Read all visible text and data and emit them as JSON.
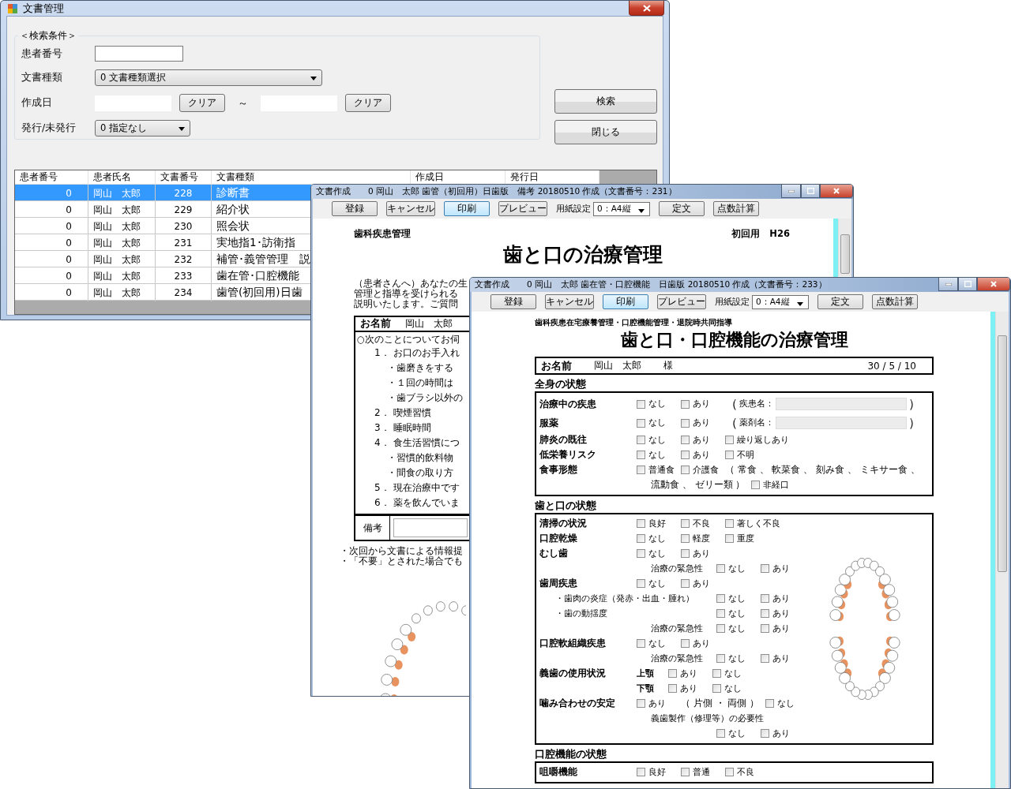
{
  "manager_window": {
    "title": "文書管理",
    "search": {
      "legend": "＜検索条件＞",
      "patient_label": "患者番号",
      "type_label": "文書種類",
      "type_value": "0 文書種類選択",
      "date_label": "作成日",
      "clear_buttons": [
        "クリア",
        "クリア"
      ],
      "separator": "～",
      "issued_label": "発行/未発行",
      "issued_value": "0 指定なし"
    },
    "buttons": [
      "検索",
      "閉じる"
    ],
    "table": {
      "columns": [
        "患者番号",
        "患者氏名",
        "文書番号",
        "文書種類",
        "作成日",
        "発行日"
      ],
      "rows": [
        {
          "cells": [
            "0",
            "岡山　太郎",
            "228",
            "診断書"
          ],
          "selected": true
        },
        {
          "cells": [
            "0",
            "岡山　太郎",
            "229",
            "紹介状"
          ],
          "selected": false
        },
        {
          "cells": [
            "0",
            "岡山　太郎",
            "230",
            "照会状"
          ],
          "selected": false
        },
        {
          "cells": [
            "0",
            "岡山　太郎",
            "231",
            "実地指1･訪衛指"
          ],
          "selected": false
        },
        {
          "cells": [
            "0",
            "岡山　太郎",
            "232",
            "補管･義管管理　説"
          ],
          "selected": false
        },
        {
          "cells": [
            "0",
            "岡山　太郎",
            "233",
            "歯在管･口腔機能"
          ],
          "selected": false
        },
        {
          "cells": [
            "0",
            "岡山　太郎",
            "234",
            "歯管(初回用)日歯"
          ],
          "selected": false
        }
      ]
    }
  },
  "letter_window": {
    "title": "文書作成　　0 岡山　太郎 歯管（初回用）日歯版　備考 20180510 作成（文書番号：231）",
    "toolbar": [
      {
        "kind": "button",
        "label": "登録",
        "default": false
      },
      {
        "kind": "button",
        "label": "キャンセル",
        "default": false
      },
      {
        "kind": "button",
        "label": "印刷",
        "default": true
      },
      {
        "kind": "button",
        "label": "プレビュー",
        "default": false
      },
      {
        "kind": "label",
        "label": "用紙設定"
      },
      {
        "kind": "select",
        "label": "0：A4縦"
      },
      {
        "kind": "button",
        "label": "定文",
        "default": false
      },
      {
        "kind": "button",
        "label": "点数計算",
        "default": false
      }
    ],
    "document": {
      "category": "歯科疾患管理",
      "edition": "初回用　H26",
      "heading": "歯と口の治療管理",
      "intro": [
        "（患者さんへ）あなたの生",
        "管理と指導を受けられる",
        "説明いたします。ご質問"
      ],
      "name_label": "お名前",
      "patient_name": "岡山　太郎",
      "question": "○次のことについてお伺",
      "items": [
        {
          "kind": "numbered",
          "number": "1．",
          "text": "お口のお手入れ"
        },
        {
          "kind": "bullet",
          "text": "・歯磨きをする"
        },
        {
          "kind": "bullet",
          "text": "・１回の時間は"
        },
        {
          "kind": "bullet",
          "text": "・歯ブラシ以外の"
        },
        {
          "kind": "numbered",
          "number": "2．",
          "text": "喫煙習慣"
        },
        {
          "kind": "numbered",
          "number": "3．",
          "text": "睡眠時間"
        },
        {
          "kind": "numbered",
          "number": "4．",
          "text": "食生活習慣につ"
        },
        {
          "kind": "bullet",
          "text": "・習慣的飲料物"
        },
        {
          "kind": "bullet",
          "text": "・間食の取り方"
        },
        {
          "kind": "numbered",
          "number": "5．",
          "text": "現在治療中です"
        },
        {
          "kind": "numbered",
          "number": "6．",
          "text": "薬を飲んでいま"
        }
      ],
      "remarks_label": "備考",
      "notes": [
        "・次回から文書による情報提",
        "・「不要」とされた場合でも"
      ]
    }
  },
  "form_window": {
    "title": "文書作成　　0 岡山　太郎 歯在管・口腔機能　日歯版 20180510 作成（文書番号：233）",
    "toolbar": [
      {
        "kind": "button",
        "label": "登録",
        "default": false
      },
      {
        "kind": "button",
        "label": "キャンセル",
        "default": false
      },
      {
        "kind": "button",
        "label": "印刷",
        "default": true
      },
      {
        "kind": "button",
        "label": "プレビュー",
        "default": false
      },
      {
        "kind": "label",
        "label": "用紙設定"
      },
      {
        "kind": "select",
        "label": "0：A4縦"
      },
      {
        "kind": "button",
        "label": "定文",
        "default": false
      },
      {
        "kind": "button",
        "label": "点数計算",
        "default": false
      }
    ],
    "document": {
      "category": "歯科疾患在宅療養管理・口腔機能管理・退院時共同指導",
      "heading": "歯と口・口腔機能の治療管理",
      "name_label": "お名前",
      "patient_name": "岡山　太郎",
      "honorific": "様",
      "date": "30 / 5 / 10",
      "sections": [
        {
          "title": "全身の状態",
          "kind": "plain",
          "rows": [
            {
              "kind": "main",
              "label": "治療中の疾患",
              "items": [
                {
                  "kind": "check",
                  "label": "なし",
                  "checked": false
                },
                {
                  "kind": "check",
                  "label": "あり",
                  "checked": false
                },
                {
                  "kind": "field",
                  "open": "（",
                  "label": "疾患名：",
                  "close": "）"
                }
              ]
            },
            {
              "kind": "main",
              "label": "服薬",
              "items": [
                {
                  "kind": "check",
                  "label": "なし",
                  "checked": false
                },
                {
                  "kind": "check",
                  "label": "あり",
                  "checked": false
                },
                {
                  "kind": "field",
                  "open": "（",
                  "label": "薬剤名：",
                  "close": "）"
                }
              ]
            },
            {
              "kind": "main",
              "label": "肺炎の既往",
              "items": [
                {
                  "kind": "check",
                  "label": "なし",
                  "checked": false
                },
                {
                  "kind": "check",
                  "label": "あり",
                  "checked": false
                },
                {
                  "kind": "check",
                  "label": "繰り返しあり",
                  "checked": false
                }
              ]
            },
            {
              "kind": "main",
              "label": "低栄養リスク",
              "items": [
                {
                  "kind": "check",
                  "label": "なし",
                  "checked": false
                },
                {
                  "kind": "check",
                  "label": "あり",
                  "checked": false
                },
                {
                  "kind": "check",
                  "label": "不明",
                  "checked": false
                }
              ]
            },
            {
              "kind": "main",
              "label": "食事形態",
              "items": [
                {
                  "kind": "check",
                  "label": "普通食",
                  "checked": false
                },
                {
                  "kind": "check",
                  "label": "介護食",
                  "checked": false
                },
                {
                  "kind": "text",
                  "label": "（ 常食 、 軟菜食 、 刻み食 、 ミキサー食 、"
                }
              ]
            },
            {
              "kind": "cont",
              "items": [
                {
                  "kind": "text",
                  "label": "流動食 、 ゼリー類 ）"
                },
                {
                  "kind": "check",
                  "label": "非経口",
                  "checked": false
                }
              ]
            }
          ]
        },
        {
          "title": "歯と口の状態",
          "kind": "teeth",
          "rows": [
            {
              "kind": "main",
              "label": "清掃の状況",
              "items": [
                {
                  "kind": "check",
                  "label": "良好",
                  "checked": false
                },
                {
                  "kind": "check",
                  "label": "不良",
                  "checked": false
                },
                {
                  "kind": "check",
                  "label": "著しく不良",
                  "checked": false
                }
              ]
            },
            {
              "kind": "main",
              "label": "口腔乾燥",
              "items": [
                {
                  "kind": "check",
                  "label": "なし",
                  "checked": false
                },
                {
                  "kind": "check",
                  "label": "軽度",
                  "checked": false
                },
                {
                  "kind": "check",
                  "label": "重度",
                  "checked": false
                }
              ]
            },
            {
              "kind": "main",
              "label": "むし歯",
              "items": [
                {
                  "kind": "check",
                  "label": "なし",
                  "checked": false
                },
                {
                  "kind": "check",
                  "label": "あり",
                  "checked": false
                }
              ]
            },
            {
              "kind": "sub",
              "label": "治療の緊急性",
              "items": [
                {
                  "kind": "check",
                  "label": "なし",
                  "checked": false
                },
                {
                  "kind": "check",
                  "label": "あり",
                  "checked": false
                }
              ]
            },
            {
              "kind": "main",
              "label": "歯周疾患",
              "items": [
                {
                  "kind": "check",
                  "label": "なし",
                  "checked": false
                },
                {
                  "kind": "check",
                  "label": "あり",
                  "checked": false
                }
              ]
            },
            {
              "kind": "bullet",
              "label": "・歯肉の炎症（発赤・出血・腫れ）",
              "items": [
                {
                  "kind": "check",
                  "label": "なし",
                  "checked": false
                },
                {
                  "kind": "check",
                  "label": "あり",
                  "checked": false
                }
              ]
            },
            {
              "kind": "bullet",
              "label": "・歯の動揺度",
              "items": [
                {
                  "kind": "check",
                  "label": "なし",
                  "checked": false
                },
                {
                  "kind": "check",
                  "label": "あり",
                  "checked": false
                }
              ]
            },
            {
              "kind": "sub",
              "label": "治療の緊急性",
              "items": [
                {
                  "kind": "check",
                  "label": "なし",
                  "checked": false
                },
                {
                  "kind": "check",
                  "label": "あり",
                  "checked": false
                }
              ]
            },
            {
              "kind": "main",
              "label": "口腔軟組織疾患",
              "items": [
                {
                  "kind": "check",
                  "label": "なし",
                  "checked": false
                },
                {
                  "kind": "check",
                  "label": "あり",
                  "checked": false
                }
              ]
            },
            {
              "kind": "sub",
              "label": "治療の緊急性",
              "items": [
                {
                  "kind": "check",
                  "label": "なし",
                  "checked": false
                },
                {
                  "kind": "check",
                  "label": "あり",
                  "checked": false
                }
              ]
            },
            {
              "kind": "jaw",
              "label": "義歯の使用状況",
              "sublabel": "上顎",
              "items": [
                {
                  "kind": "check",
                  "label": "あり",
                  "checked": false
                },
                {
                  "kind": "check",
                  "label": "なし",
                  "checked": false
                }
              ]
            },
            {
              "kind": "jaw",
              "sublabel": "下顎",
              "items": [
                {
                  "kind": "check",
                  "label": "あり",
                  "checked": false
                },
                {
                  "kind": "check",
                  "label": "なし",
                  "checked": false
                }
              ]
            },
            {
              "kind": "main",
              "label": "噛み合わせの安定",
              "items": [
                {
                  "kind": "check",
                  "label": "あり",
                  "checked": false
                },
                {
                  "kind": "text",
                  "label": "（ 片側 ・ 両側 ）"
                },
                {
                  "kind": "check",
                  "label": "なし",
                  "checked": false
                }
              ]
            },
            {
              "kind": "sub",
              "label": "義歯製作（修理等）の必要性",
              "items": []
            },
            {
              "kind": "sub",
              "items": [
                {
                  "kind": "check",
                  "label": "なし",
                  "checked": false
                },
                {
                  "kind": "check",
                  "label": "あり",
                  "checked": false
                }
              ]
            }
          ]
        },
        {
          "title": "口腔機能の状態",
          "kind": "plain",
          "rows": [
            {
              "kind": "main",
              "label": "咀嚼機能",
              "items": [
                {
                  "kind": "check",
                  "label": "良好",
                  "checked": false
                },
                {
                  "kind": "check",
                  "label": "普通",
                  "checked": false
                },
                {
                  "kind": "check",
                  "label": "不良",
                  "checked": false
                }
              ]
            }
          ]
        }
      ]
    }
  }
}
